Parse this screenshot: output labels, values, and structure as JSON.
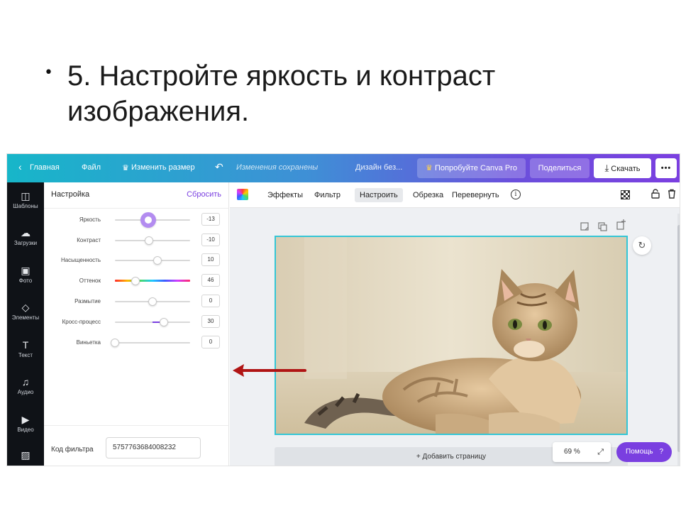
{
  "slide": {
    "bullet": "•",
    "title_line1": "5. Настройте яркость и контраст",
    "title_line2": "изображения."
  },
  "topbar": {
    "back_arrow": "‹",
    "home": "Главная",
    "file": "Файл",
    "resize_icon": "♛",
    "resize": "Изменить размер",
    "undo_icon": "↶",
    "saved_status": "Изменения сохранены",
    "design_title": "Дизайн без...",
    "pro_icon": "♛",
    "try_pro": "Попробуйте Canva Pro",
    "share": "Поделиться",
    "download_icon": "⤓",
    "download": "Скачать",
    "more": "•••"
  },
  "rail": {
    "items": [
      {
        "icon": "layout-icon",
        "glyph": "◫",
        "label": "Шаблоны"
      },
      {
        "icon": "upload-icon",
        "glyph": "☁",
        "label": "Загрузки"
      },
      {
        "icon": "photo-icon",
        "glyph": "▣",
        "label": "Фото"
      },
      {
        "icon": "elements-icon",
        "glyph": "◇",
        "label": "Элементы"
      },
      {
        "icon": "text-icon",
        "glyph": "T",
        "label": "Текст"
      },
      {
        "icon": "audio-icon",
        "glyph": "♫",
        "label": "Аудио"
      },
      {
        "icon": "video-icon",
        "glyph": "▶",
        "label": "Видео"
      },
      {
        "icon": "background-icon",
        "glyph": "▨",
        "label": ""
      }
    ]
  },
  "panel": {
    "title": "Настройка",
    "reset": "Сбросить",
    "sliders": [
      {
        "label": "Яркость",
        "value": "-13",
        "pos": 0.44,
        "fill_from": null,
        "active": true,
        "hue": false
      },
      {
        "label": "Контраст",
        "value": "-10",
        "pos": 0.45,
        "fill_from": null,
        "active": false,
        "hue": false
      },
      {
        "label": "Насыщенность",
        "value": "10",
        "pos": 0.57,
        "fill_from": null,
        "active": false,
        "hue": false
      },
      {
        "label": "Оттенок",
        "value": "46",
        "pos": 0.27,
        "fill_from": null,
        "active": false,
        "hue": true
      },
      {
        "label": "Размытие",
        "value": "0",
        "pos": 0.5,
        "fill_from": null,
        "active": false,
        "hue": false
      },
      {
        "label": "Кросс-процесс",
        "value": "30",
        "pos": 0.65,
        "fill_from": 0.5,
        "active": false,
        "hue": false
      },
      {
        "label": "Виньетка",
        "value": "0",
        "pos": 0.0,
        "fill_from": null,
        "active": false,
        "hue": false
      }
    ],
    "filter_code_label": "Код фильтра",
    "filter_code_value": "5757763684008232"
  },
  "image_toolbar": {
    "effects": "Эффекты",
    "filter": "Фильтр",
    "adjust": "Настроить",
    "crop": "Обрезка",
    "flip": "Перевернуть",
    "info": "i",
    "lock_icon": "🔓",
    "trash_icon": "🗑"
  },
  "canvas": {
    "page_icons": [
      "⧉",
      "⧉",
      "+"
    ],
    "rotate_icon": "↻",
    "add_page": "+ Добавить страницу",
    "zoom": "69 %",
    "zoom_icon": "⤢",
    "help": "Помощь",
    "help_icon": "?"
  },
  "colors": {
    "accent": "#7a3fe0",
    "selection": "#33c6d6",
    "arrow": "#b01414"
  }
}
